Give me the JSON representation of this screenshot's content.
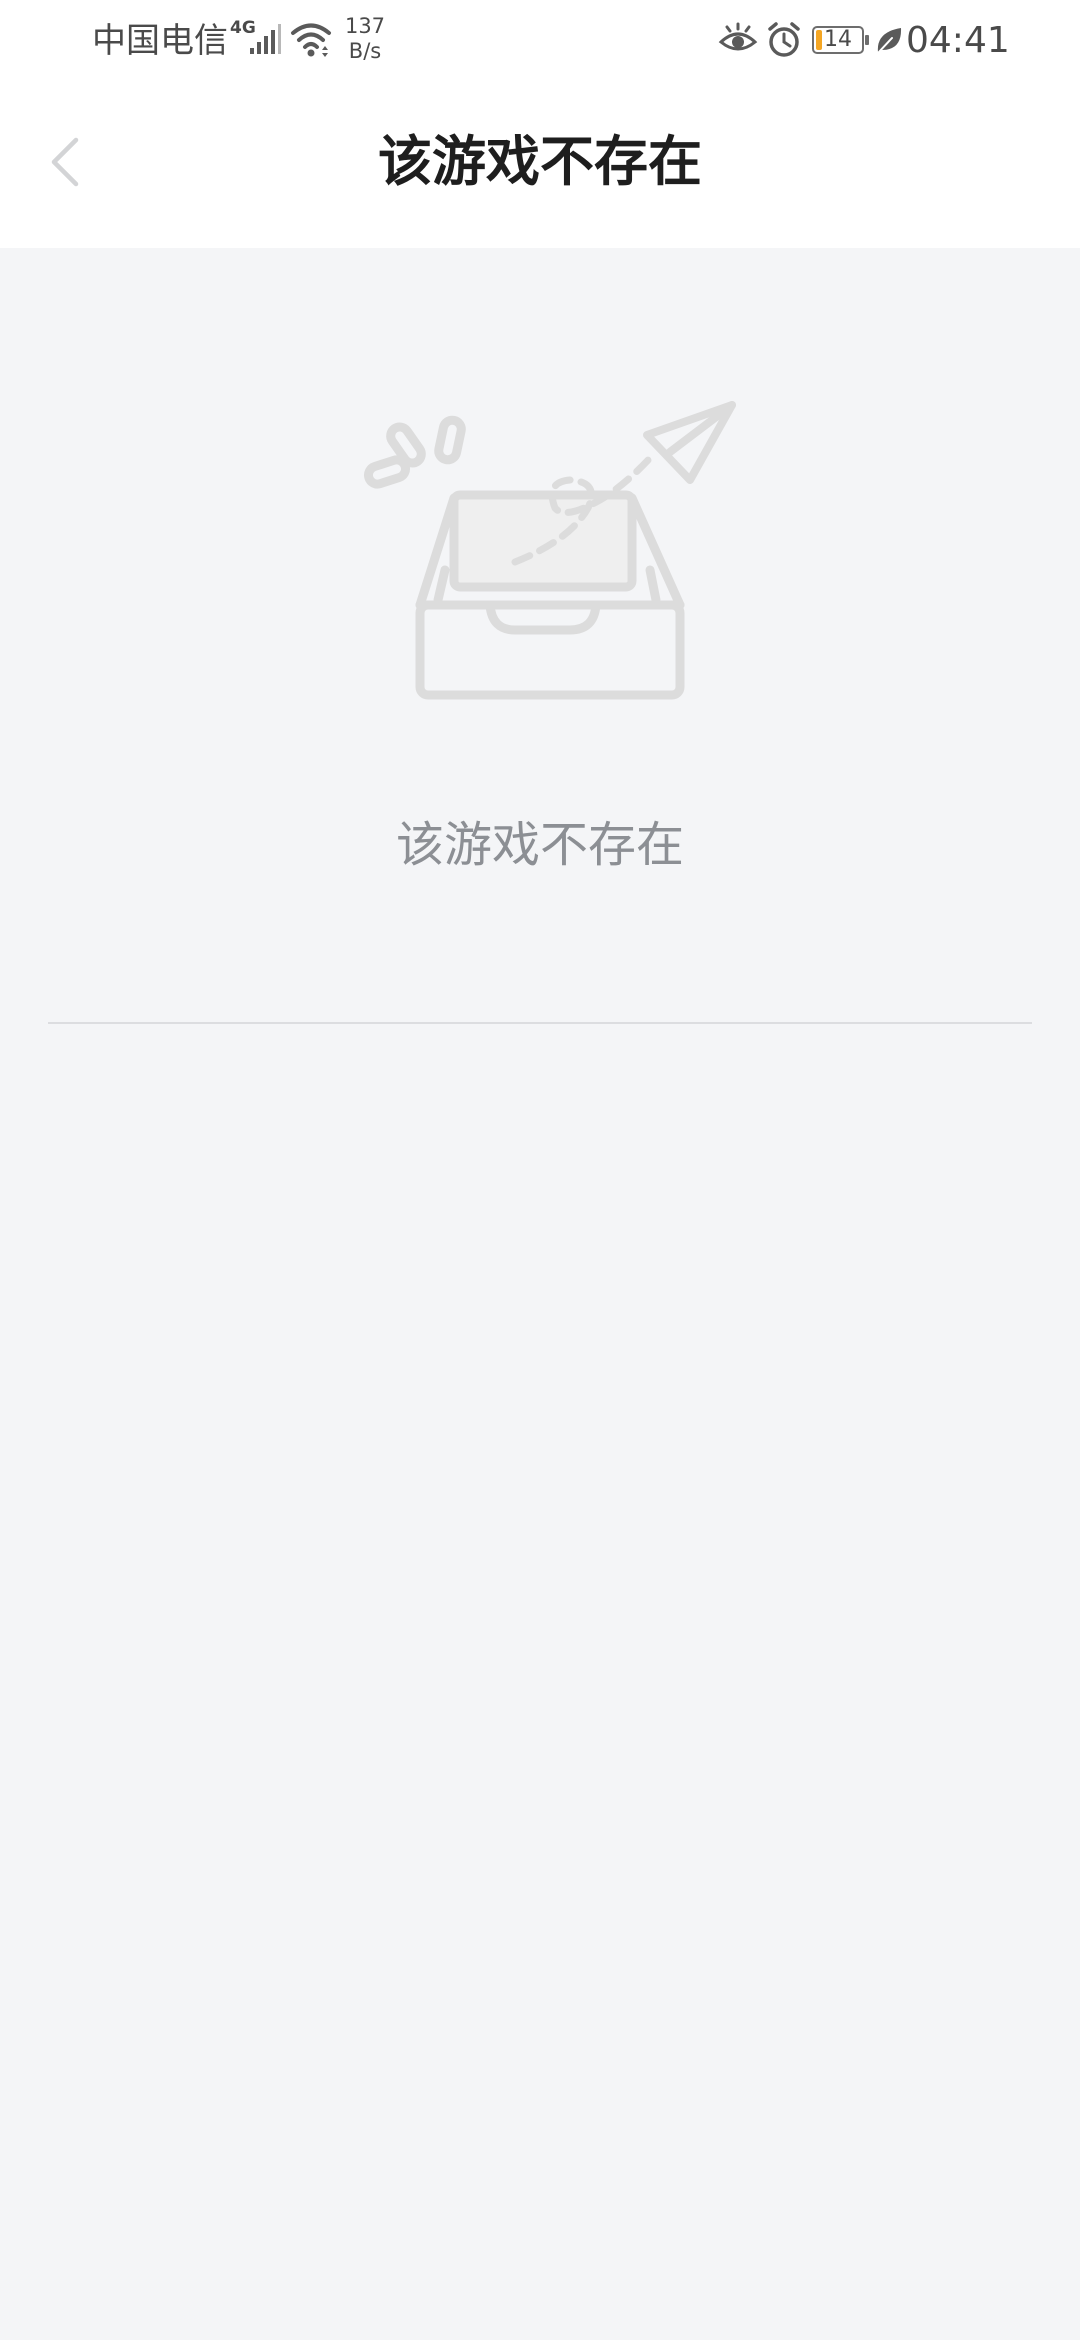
{
  "status_bar": {
    "carrier": "中国电信",
    "network_type": "4G",
    "net_speed_value": "137",
    "net_speed_unit": "B/s",
    "battery_level": "14",
    "time": "04:41",
    "icons": [
      "signal-icon",
      "wifi-icon",
      "eye-icon",
      "alarm-icon",
      "battery-icon",
      "leaf-icon"
    ]
  },
  "nav": {
    "back_icon": "chevron-left-icon",
    "title": "该游戏不存在"
  },
  "empty_state": {
    "illustration": "empty-inbox-paper-plane-illustration",
    "message": "该游戏不存在"
  },
  "colors": {
    "background": "#f4f5f7",
    "header_background": "#ffffff",
    "title_text": "#1e1e1e",
    "empty_text": "#8c8f94",
    "illustration": "#dcdcdc",
    "battery_fill": "#f5a623"
  }
}
